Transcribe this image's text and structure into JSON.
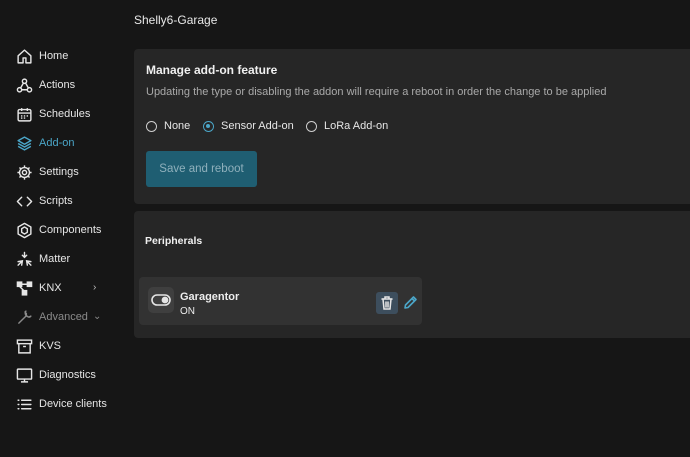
{
  "device_title": "Shelly6-Garage",
  "colors": {
    "accent": "#4ba6c8",
    "background": "#161616",
    "card": "#262626",
    "save_button": "#1f5e72"
  },
  "sidebar": {
    "items": [
      {
        "label": "Home",
        "icon": "home-icon"
      },
      {
        "label": "Actions",
        "icon": "webhook-icon"
      },
      {
        "label": "Schedules",
        "icon": "calendar-icon"
      },
      {
        "label": "Add-on",
        "icon": "layers-icon",
        "active": true
      },
      {
        "label": "Settings",
        "icon": "gear-icon"
      },
      {
        "label": "Scripts",
        "icon": "code-icon"
      },
      {
        "label": "Components",
        "icon": "components-icon"
      },
      {
        "label": "Matter",
        "icon": "matter-icon"
      },
      {
        "label": "KNX",
        "icon": "knx-icon",
        "expandable": true
      },
      {
        "label": "Advanced",
        "icon": "wrench-icon",
        "expandable": true
      },
      {
        "label": "KVS",
        "icon": "archive-icon"
      },
      {
        "label": "Diagnostics",
        "icon": "monitor-icon"
      },
      {
        "label": "Device clients",
        "icon": "list-icon"
      }
    ]
  },
  "addon": {
    "title": "Manage add-on feature",
    "description": "Updating the type or disabling the addon will require a reboot in order the change to be applied",
    "options": [
      "None",
      "Sensor Add-on",
      "LoRa Add-on"
    ],
    "selected": "Sensor Add-on",
    "save_label": "Save and reboot"
  },
  "peripherals": {
    "title": "Peripherals",
    "items": [
      {
        "name": "Garagentor",
        "state": "ON",
        "icon": "toggle-icon"
      }
    ]
  }
}
